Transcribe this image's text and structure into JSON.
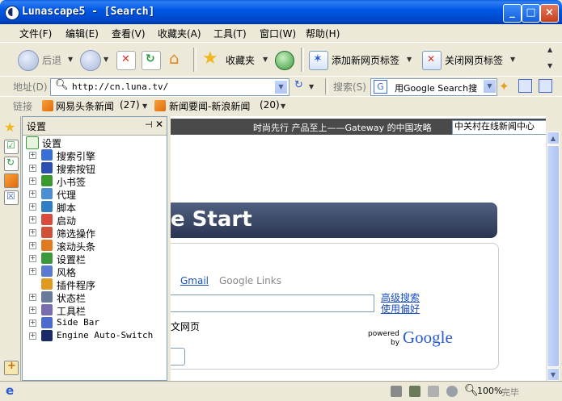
{
  "window": {
    "title": "Lunascape5 - [Search]"
  },
  "menu": [
    "文件(F)",
    "编辑(E)",
    "查看(V)",
    "收藏夹(A)",
    "工具(T)",
    "窗口(W)",
    "帮助(H)"
  ],
  "toolbar": {
    "back_label": "后退",
    "favorites_label": "收藏夹",
    "add_tab_label": "添加新网页标签",
    "close_tab_label": "关闭网页标签"
  },
  "address": {
    "label": "地址(D)",
    "url": "http://cn.luna.tv/",
    "search_label": "搜索(S)",
    "search_value": "用Google Search搜"
  },
  "links": {
    "label": "链接",
    "items": [
      {
        "label": "网易头条新闻",
        "count": "(27)"
      },
      {
        "label": "新闻要闻-新浪新闻",
        "count": "(20)"
      }
    ]
  },
  "sidebar": {
    "title": "设置",
    "root": "设置",
    "items": [
      {
        "label": "搜索引擎",
        "color": "#3a6fd8"
      },
      {
        "label": "搜索按钮",
        "color": "#2a4fb0"
      },
      {
        "label": "小书签",
        "color": "#3b9a2d"
      },
      {
        "label": "代理",
        "color": "#4a8fd0"
      },
      {
        "label": "脚本",
        "color": "#2f7ec4"
      },
      {
        "label": "启动",
        "color": "#d84a3a"
      },
      {
        "label": "筛选操作",
        "color": "#d0503a"
      },
      {
        "label": "滚动头条",
        "color": "#e07a20"
      },
      {
        "label": "设置栏",
        "color": "#3a9a3a"
      },
      {
        "label": "风格",
        "color": "#5a7ad0"
      },
      {
        "label": "插件程序",
        "color": "#e09a20"
      },
      {
        "label": "状态栏",
        "color": "#6a7a9a"
      },
      {
        "label": "工具栏",
        "color": "#7a6ab0"
      },
      {
        "label": "Side Bar",
        "color": "#4a6ad0"
      },
      {
        "label": "Engine Auto-Switch",
        "color": "#1a2a66"
      }
    ]
  },
  "content": {
    "marquee": "时尚先行 产品至上——Gateway 的中国攻略",
    "news_select": "中关村在线新闻中心",
    "banner": "e Start",
    "gmail": "Gmail",
    "google_links": "Google Links",
    "advanced_search": "高级搜索",
    "preferences": "使用偏好",
    "web_label": "文网页",
    "powered": "powered",
    "by": "by",
    "google": "Google"
  },
  "status": {
    "zoom": "100%",
    "done": "完毕"
  }
}
